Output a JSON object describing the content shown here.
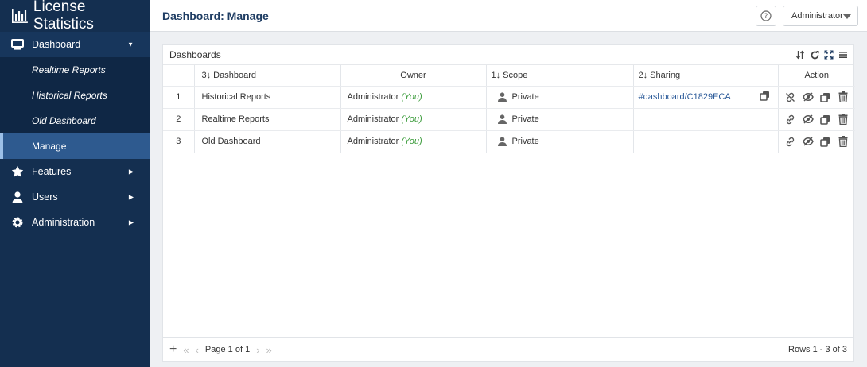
{
  "app": {
    "title": "License Statistics"
  },
  "sidebar": {
    "dashboard": {
      "label": "Dashboard",
      "icon": "monitor-icon"
    },
    "subitems": [
      {
        "label": "Realtime Reports"
      },
      {
        "label": "Historical Reports"
      },
      {
        "label": "Old Dashboard"
      },
      {
        "label": "Manage"
      }
    ],
    "items": [
      {
        "label": "Features",
        "icon": "star-icon"
      },
      {
        "label": "Users",
        "icon": "user-icon"
      },
      {
        "label": "Administration",
        "icon": "gear-icon"
      }
    ]
  },
  "header": {
    "title": "Dashboard: Manage",
    "help": "?",
    "user": "Administrator"
  },
  "panel": {
    "title": "Dashboards",
    "columns": {
      "dashboard": "3↓ Dashboard",
      "owner": "Owner",
      "scope": "1↓ Scope",
      "sharing": "2↓ Sharing",
      "action": "Action"
    },
    "rows": [
      {
        "num": "1",
        "dashboard": "Historical Reports",
        "owner": "Administrator",
        "you": "(You)",
        "scope": "Private",
        "sharing": "#dashboard/C1829ECA"
      },
      {
        "num": "2",
        "dashboard": "Realtime Reports",
        "owner": "Administrator",
        "you": "(You)",
        "scope": "Private",
        "sharing": ""
      },
      {
        "num": "3",
        "dashboard": "Old Dashboard",
        "owner": "Administrator",
        "you": "(You)",
        "scope": "Private",
        "sharing": ""
      }
    ],
    "footer": {
      "add": "+",
      "page": "Page 1 of 1",
      "rows": "Rows 1 - 3 of 3"
    }
  },
  "colors": {
    "sidebar": "#142f50",
    "active": "#2e5a8f",
    "link": "#2b5a99",
    "you": "#3a9b3a"
  }
}
